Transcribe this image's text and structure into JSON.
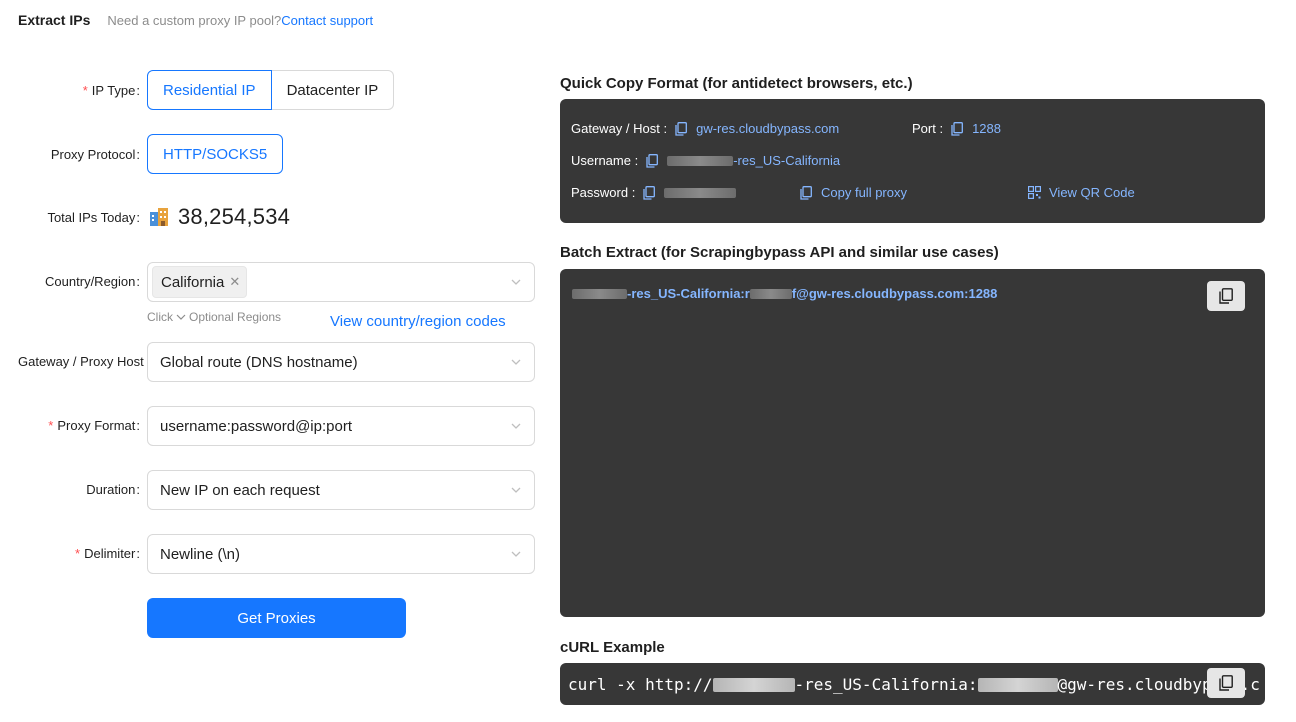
{
  "header": {
    "title": "Extract IPs",
    "subtitle": "Need a custom proxy IP pool?",
    "contact_link": "Contact support"
  },
  "form": {
    "ip_type": {
      "label": "IP Type",
      "required": "*",
      "options": [
        "Residential IP",
        "Datacenter IP"
      ],
      "selected": "Residential IP"
    },
    "protocol": {
      "label": "Proxy Protocol",
      "value": "HTTP/SOCKS5"
    },
    "total_ips": {
      "label": "Total IPs Today",
      "icon": "building-icon",
      "value": "38,254,534"
    },
    "country": {
      "label": "Country/Region",
      "tag": "California",
      "hint_prefix": "Click",
      "hint_suffix": "Optional Regions",
      "codes_link": "View country/region codes"
    },
    "gateway": {
      "label": "Gateway / Proxy Host",
      "value": "Global route (DNS hostname)"
    },
    "proxy_format": {
      "label": "Proxy Format",
      "required": "*",
      "value": "username:password@ip:port"
    },
    "duration": {
      "label": "Duration",
      "value": "New IP on each request"
    },
    "delimiter": {
      "label": "Delimiter",
      "required": "*",
      "value": "Newline (\\n)"
    },
    "submit_label": "Get Proxies"
  },
  "quick_copy": {
    "title": "Quick Copy Format (for antidetect browsers, etc.)",
    "host_label": "Gateway / Host :",
    "host_value": "gw-res.cloudbypass.com",
    "port_label": "Port :",
    "port_value": "1288",
    "username_label": "Username :",
    "username_suffix": "-res_US-California",
    "password_label": "Password :",
    "copy_full_label": "Copy full proxy",
    "qr_label": "View QR Code"
  },
  "batch": {
    "title": "Batch Extract (for Scrapingbypass API and similar use cases)",
    "line_mid": "-res_US-California:r",
    "line_end": "f@gw-res.cloudbypass.com:1288"
  },
  "curl": {
    "title": "cURL Example",
    "prefix": "curl -x http://",
    "mid": "-res_US-California:",
    "end": "@gw-res.cloudbypass.c"
  },
  "colors": {
    "accent": "#1677ff",
    "panel": "#373737",
    "link_on_dark": "#85b6ff",
    "required": "#ff4d4f"
  }
}
